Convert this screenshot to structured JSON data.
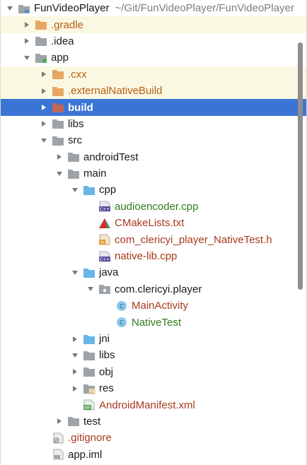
{
  "project": {
    "name": "FunVideoPlayer",
    "path": "~/Git/FunVideoPlayer/FunVideoPlayer"
  },
  "tree": {
    "gradle": ".gradle",
    "idea": ".idea",
    "app": "app",
    "cxx": ".cxx",
    "externalNativeBuild": ".externalNativeBuild",
    "build": "build",
    "libs": "libs",
    "src": "src",
    "androidTest": "androidTest",
    "main": "main",
    "cpp": "cpp",
    "audioencoder": "audioencoder.cpp",
    "cmakelists": "CMakeLists.txt",
    "nativeTestHeader": "com_clericyi_player_NativeTest.h",
    "nativeLib": "native-lib.cpp",
    "java": "java",
    "package": "com.clericyi.player",
    "mainActivity": "MainActivity",
    "nativeTest": "NativeTest",
    "jni": "jni",
    "mainLibs": "libs",
    "obj": "obj",
    "res": "res",
    "manifest": "AndroidManifest.xml",
    "test": "test",
    "gitignore": ".gitignore",
    "appIml": "app.iml"
  },
  "icon_text": {
    "cpp_badge": "C++",
    "h_badge": "H",
    "class_badge": "C",
    "mf_badge": "MF"
  },
  "colors": {
    "selection": "#3a75d6",
    "highlight_row": "#fbf8e2",
    "folder_gray": "#9ea3a8",
    "folder_orange": "#e8a562",
    "folder_blue": "#69b5e8",
    "file_red": "#a83a1e",
    "file_green": "#2f7d1a"
  }
}
